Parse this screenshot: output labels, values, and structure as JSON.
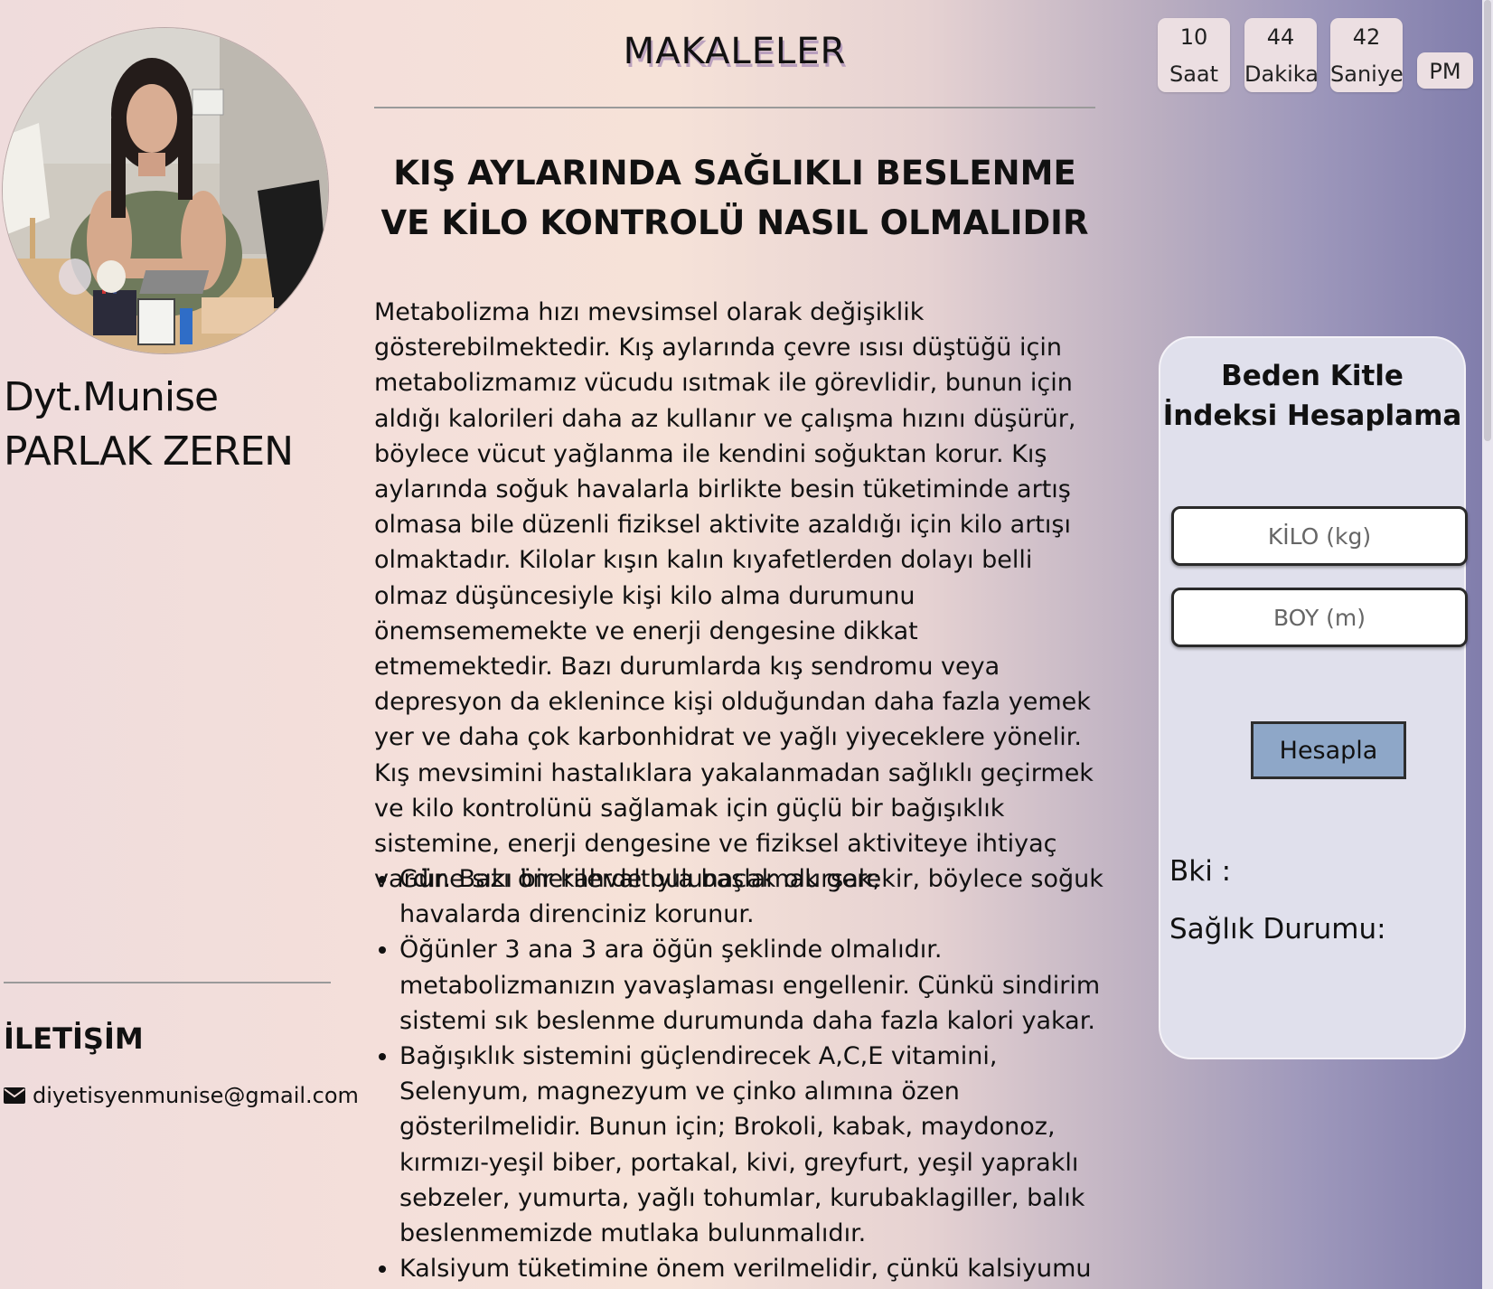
{
  "sidebar": {
    "profile_name": "Dyt.Munise PARLAK ZEREN",
    "contact_title": "İLETİŞİM",
    "email": "diyetisyenmunise@gmail.com"
  },
  "main": {
    "section_title": "MAKALELER",
    "article": {
      "title": "KIŞ AYLARINDA SAĞLIKLI BESLENME VE KİLO KONTROLÜ NASIL OLMALIDIR",
      "intro": "Metabolizma hızı mevsimsel olarak değişiklik gösterebilmektedir. Kış aylarında çevre ısısı düştüğü için metabolizmamız vücudu ısıtmak ile görevlidir, bunun için aldığı kalorileri daha az kullanır ve çalışma hızını düşürür, böylece vücut yağlanma ile kendini soğuktan korur. Kış aylarında soğuk havalarla birlikte besin tüketiminde artış olmasa bile düzenli fiziksel aktivite azaldığı için kilo artışı olmaktadır. Kilolar kışın kalın kıyafetlerden dolayı belli olmaz düşüncesiyle kişi kilo alma durumunu önemsememekte ve enerji dengesine dikkat etmemektedir. Bazı durumlarda kış sendromu veya depresyon da eklenince kişi olduğundan daha fazla yemek yer ve daha çok karbonhidrat ve yağlı yiyeceklere yönelir. Kış mevsimini hastalıklara yakalanmadan sağlıklı geçirmek ve kilo kontrolünü sağlamak için güçlü bir bağışıklık sistemine, enerji dengesine ve fiziksel aktiviteye ihtiyaç vardır. Bazı önerilerde bulunacak olursak;",
      "tips": [
        "Güne sıkı bir kahvaltıyla başlamak gerekir, böylece soğuk havalarda direnciniz korunur.",
        "Öğünler 3 ana 3 ara öğün şeklinde olmalıdır. metabolizmanızın yavaşlaması engellenir. Çünkü sindirim sistemi sık beslenme durumunda daha fazla kalori yakar.",
        "Bağışıklık sistemini güçlendirecek A,C,E vitamini, Selenyum, magnezyum ve çinko alımına özen gösterilmelidir. Bunun için; Brokoli, kabak, maydonoz, kırmızı-yeşil biber, portakal, kivi, greyfurt, yeşil yapraklı sebzeler, yumurta, yağlı tohumlar, kurubaklagiller, balık beslenmemizde mutlaka bulunmalıdır.",
        "Kalsiyum tüketimine önem verilmelidir, çünkü kalsiyumu"
      ]
    }
  },
  "clock": {
    "hours": "10",
    "hours_label": "Saat",
    "minutes": "44",
    "minutes_label": "Dakika",
    "seconds": "42",
    "seconds_label": "Saniye",
    "period": "PM"
  },
  "bmi": {
    "title": "Beden Kitle İndeksi Hesaplama",
    "weight_placeholder": "KİLO (kg)",
    "height_placeholder": "BOY (m)",
    "button_label": "Hesapla",
    "bmi_label": "Bki :",
    "status_label": "Sağlık Durumu:"
  },
  "colors": {
    "button_bg": "#8ea7c8",
    "card_bg": "#e0e0ec",
    "background_left": "#efdcdc",
    "background_right": "#7f7cab"
  },
  "icons": {
    "email": "envelope-icon"
  }
}
